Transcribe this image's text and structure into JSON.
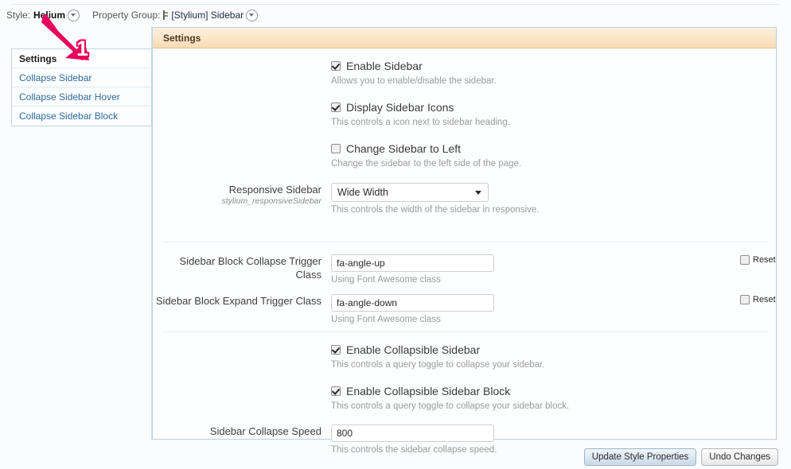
{
  "topbar": {
    "style_label": "Style:",
    "style_value": "Helium",
    "property_group_label": "Property Group:",
    "property_group_value": "[Stylium] Sidebar",
    "style_caret_icon": "chevron-down-circle-icon",
    "pg_caret_icon": "chevron-down-circle-icon",
    "pg_prefix_icon": "property-group-icon"
  },
  "sidebar": {
    "items": [
      {
        "label": "Settings",
        "active": true
      },
      {
        "label": "Collapse Sidebar",
        "active": false
      },
      {
        "label": "Collapse Sidebar Hover",
        "active": false
      },
      {
        "label": "Collapse Sidebar Block",
        "active": false
      }
    ]
  },
  "panel": {
    "header": "Settings",
    "rows": {
      "enable_sidebar": {
        "label": "Enable Sidebar",
        "help": "Allows you to enable/disable the sidebar.",
        "checked": true
      },
      "display_sidebar_icons": {
        "label": "Display Sidebar Icons",
        "help": "This controls a icon next to sidebar heading.",
        "checked": true
      },
      "change_sidebar_to_left": {
        "label": "Change Sidebar to Left",
        "help": "Change the sidebar to the left side of the page.",
        "checked": false
      },
      "responsive_sidebar": {
        "label": "Responsive Sidebar",
        "sublabel": "stylium_responsiveSidebar",
        "value": "Wide Width",
        "options": [
          "Wide Width"
        ],
        "help": "This controls the width of the sidebar in responsive.",
        "arrow_icon": "chevron-down-icon"
      },
      "collapse_trigger_class": {
        "label": "Sidebar Block Collapse Trigger Class",
        "value": "fa-angle-up",
        "help": "Using Font Awesome class",
        "reset_label": "Reset",
        "reset_checked": false
      },
      "expand_trigger_class": {
        "label": "Sidebar Block Expand Trigger Class",
        "value": "fa-angle-down",
        "help": "Using Font Awesome class",
        "reset_label": "Reset",
        "reset_checked": false
      },
      "enable_collapsible_sidebar": {
        "label": "Enable Collapsible Sidebar",
        "help": "This controls a query toggle to collapse your sidebar.",
        "checked": true
      },
      "enable_collapsible_sidebar_block": {
        "label": "Enable Collapsible Sidebar Block",
        "help": "This controls a query toggle to collapse your sidebar block.",
        "checked": true
      },
      "sidebar_collapse_speed": {
        "label": "Sidebar Collapse Speed",
        "value": "800",
        "help": "This controls the sidebar collapse speed."
      }
    }
  },
  "footer": {
    "update_label": "Update Style Properties",
    "undo_label": "Undo Changes"
  },
  "annotation": {
    "number": "1",
    "color": "#e6005c"
  },
  "colors": {
    "panel_border": "#bcd6e6",
    "header_bg": "#f9dcb6",
    "link": "#2c6b9e",
    "annotation": "#e6005c"
  }
}
